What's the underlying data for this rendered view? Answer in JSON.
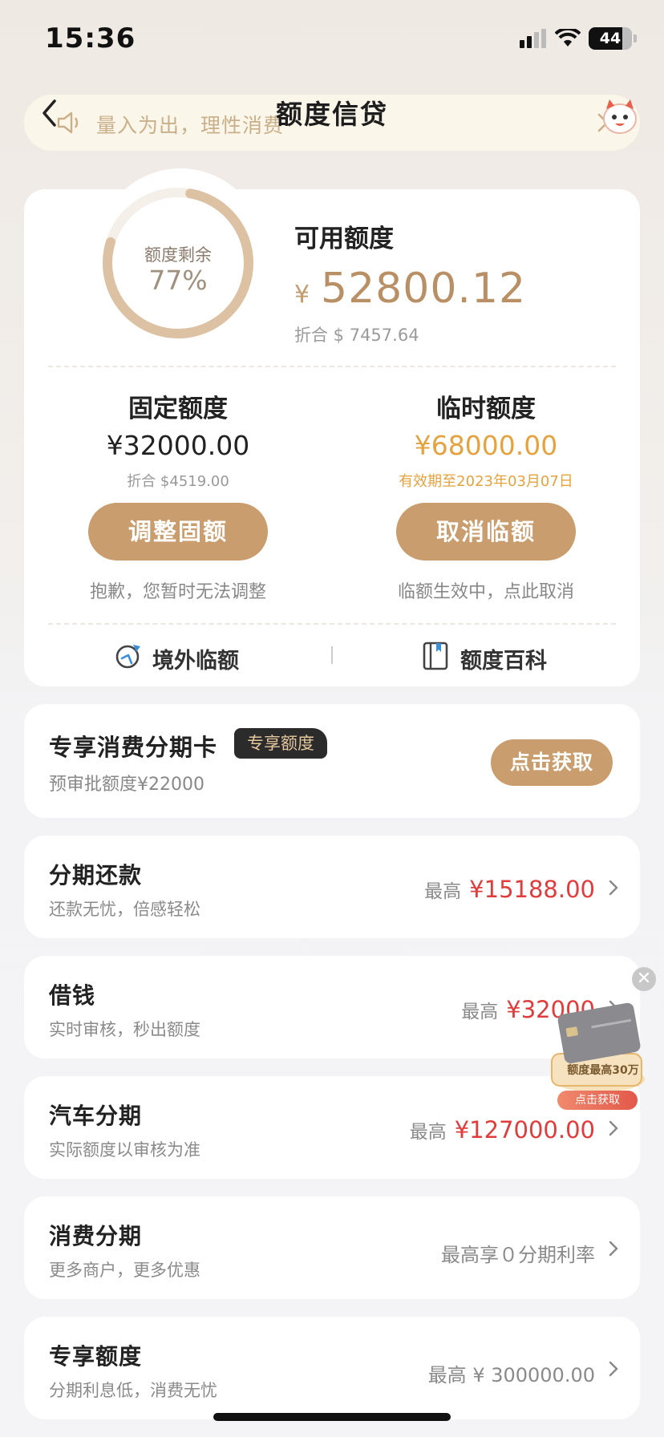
{
  "status_bar": {
    "time": "15:36",
    "battery": "44"
  },
  "nav": {
    "title": "额度信贷"
  },
  "notice": {
    "text": "量入为出，理性消费"
  },
  "quota": {
    "ring_label": "额度剩余",
    "ring_percent": "77%",
    "ring_fraction": 0.77,
    "available_title": "可用额度",
    "currency_symbol": "¥",
    "available_amount": "52800.12",
    "available_converted": "折合 $ 7457.64",
    "fixed": {
      "title": "固定额度",
      "amount": "¥32000.00",
      "sub": "折合 $4519.00",
      "button": "调整固额",
      "note": "抱歉，您暂时无法调整"
    },
    "temporary": {
      "title": "临时额度",
      "amount": "¥68000.00",
      "sub": "有效期至2023年03月07日",
      "button": "取消临额",
      "note": "临额生效中，点此取消"
    },
    "links": {
      "overseas": "境外临额",
      "wiki": "额度百科"
    }
  },
  "promo": {
    "title": "专享消费分期卡",
    "badge": "专享额度",
    "sub": "预审批额度¥22000",
    "button": "点击获取"
  },
  "rows": [
    {
      "title": "分期还款",
      "sub": "还款无忧，倍感轻松",
      "prefix": "最高",
      "amount": "¥15188.00"
    },
    {
      "title": "借钱",
      "sub": "实时审核，秒出额度",
      "prefix": "最高",
      "amount": "¥32000"
    },
    {
      "title": "汽车分期",
      "sub": "实际额度以审核为准",
      "prefix": "最高",
      "amount": "¥127000.00"
    },
    {
      "title": "消费分期",
      "sub": "更多商户，更多优惠",
      "prefix": "",
      "amount": "最高享０分期利率"
    },
    {
      "title": "专享额度",
      "sub": "分期利息低，消费无忧",
      "prefix": "",
      "amount": "最高 ¥ 300000.00"
    }
  ],
  "floating_ad": {
    "text": "额度最高30万",
    "button": "点击获取",
    "close": "✕"
  },
  "colors": {
    "accent": "#c99d6d",
    "gold_text": "#e5a23f",
    "red": "#e23b3b"
  }
}
